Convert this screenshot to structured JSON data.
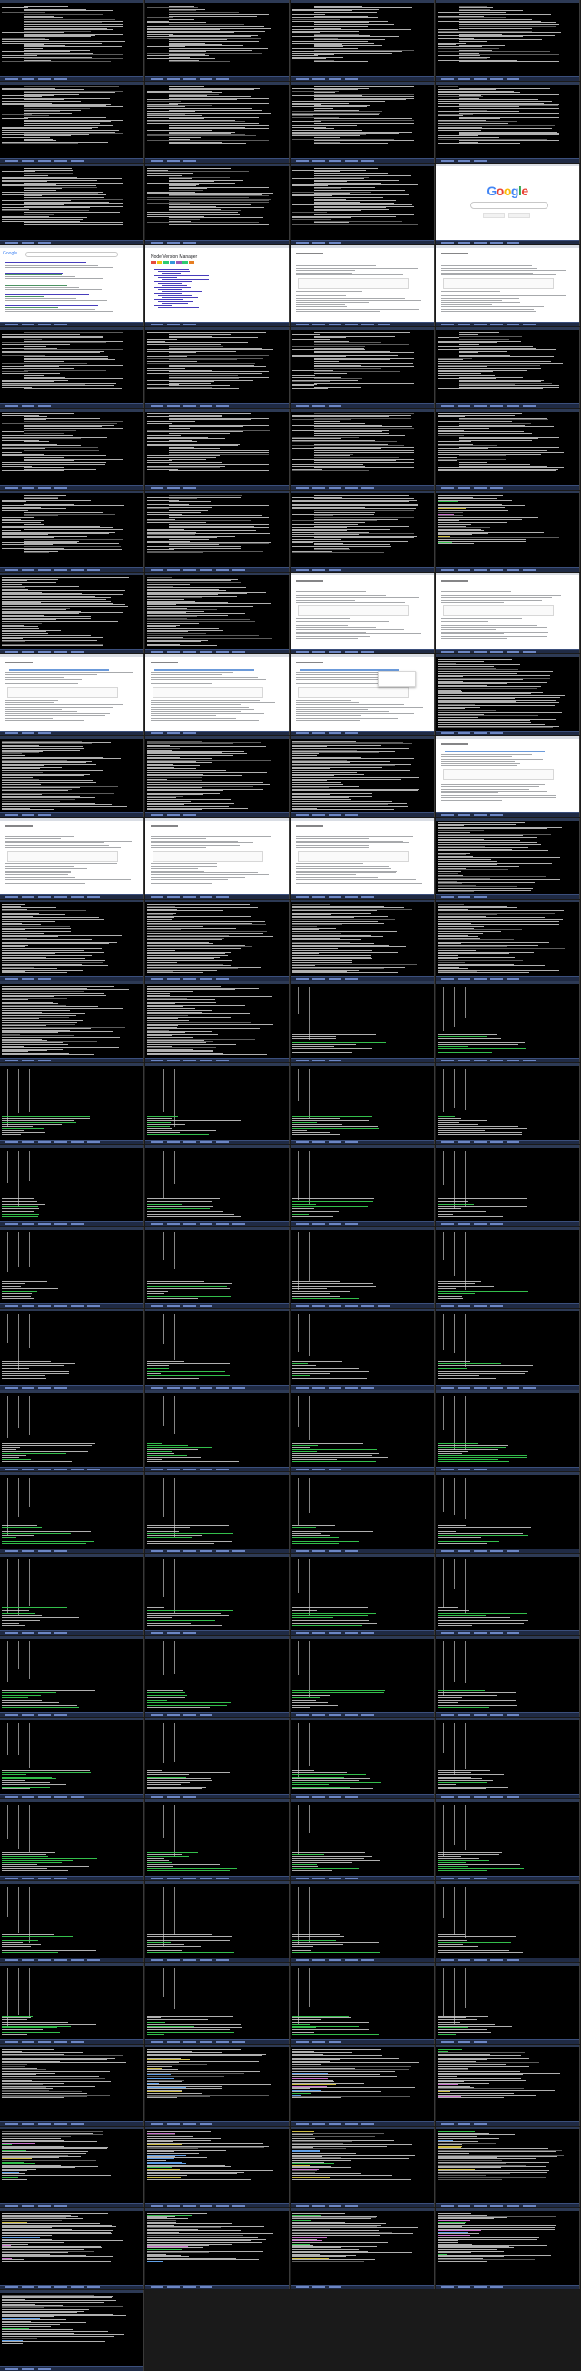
{
  "meta": {
    "title": ""
  },
  "taskbar": {
    "clock": ""
  },
  "frames": [
    "terminal",
    "terminal",
    "terminal",
    "terminal",
    "terminal",
    "terminal",
    "terminal",
    "terminal",
    "terminal",
    "terminal",
    "terminal",
    "google-home",
    "google-results",
    "doc-toc",
    "doc-page",
    "doc-page",
    "terminal",
    "terminal",
    "terminal",
    "terminal",
    "terminal",
    "terminal",
    "terminal",
    "terminal",
    "terminal",
    "terminal",
    "terminal",
    "terminal-color",
    "terminal-dense",
    "terminal-dense",
    "doc-page",
    "doc-page",
    "doc-page-bar",
    "doc-page-bar",
    "doc-page-popup",
    "terminal-dense",
    "terminal-dense",
    "terminal-dense",
    "terminal-dense",
    "doc-page-bar",
    "doc-page",
    "doc-page",
    "doc-page",
    "terminal-dense",
    "terminal-dense",
    "terminal-dense",
    "terminal-dense",
    "terminal-dense",
    "terminal-dense",
    "terminal-dense",
    "terminal-cols",
    "terminal-cols",
    "terminal-cols",
    "terminal-cols",
    "terminal-cols",
    "terminal-cols",
    "terminal-cols",
    "terminal-cols",
    "terminal-cols",
    "terminal-cols",
    "terminal-cols",
    "terminal-cols",
    "terminal-cols",
    "terminal-cols",
    "terminal-cols",
    "terminal-cols",
    "terminal-cols",
    "terminal-cols",
    "terminal-cols",
    "terminal-cols",
    "terminal-cols",
    "terminal-cols",
    "terminal-cols",
    "terminal-cols",
    "terminal-cols",
    "terminal-cols",
    "terminal-cols",
    "terminal-cols",
    "terminal-cols",
    "terminal-cols",
    "terminal-cols",
    "terminal-cols",
    "terminal-cols",
    "terminal-cols",
    "terminal-cols",
    "terminal-cols",
    "terminal-cols",
    "terminal-cols",
    "terminal-cols",
    "terminal-cols",
    "terminal-cols",
    "terminal-cols",
    "terminal-cols",
    "terminal-cols",
    "terminal-cols",
    "terminal-cols",
    "terminal-cols",
    "terminal-cols",
    "terminal-cols",
    "terminal-cols",
    "terminal-color",
    "terminal-color",
    "terminal-color",
    "terminal-color",
    "terminal-color",
    "terminal-color",
    "terminal-color",
    "terminal-color",
    "terminal-color",
    "terminal-color",
    "terminal-color",
    "terminal-color",
    "terminal-color",
    "empty",
    "empty",
    "empty"
  ],
  "google": {
    "logo": [
      "G",
      "o",
      "o",
      "g",
      "l",
      "e"
    ]
  },
  "doc": {
    "title": "Node Version Manager"
  }
}
